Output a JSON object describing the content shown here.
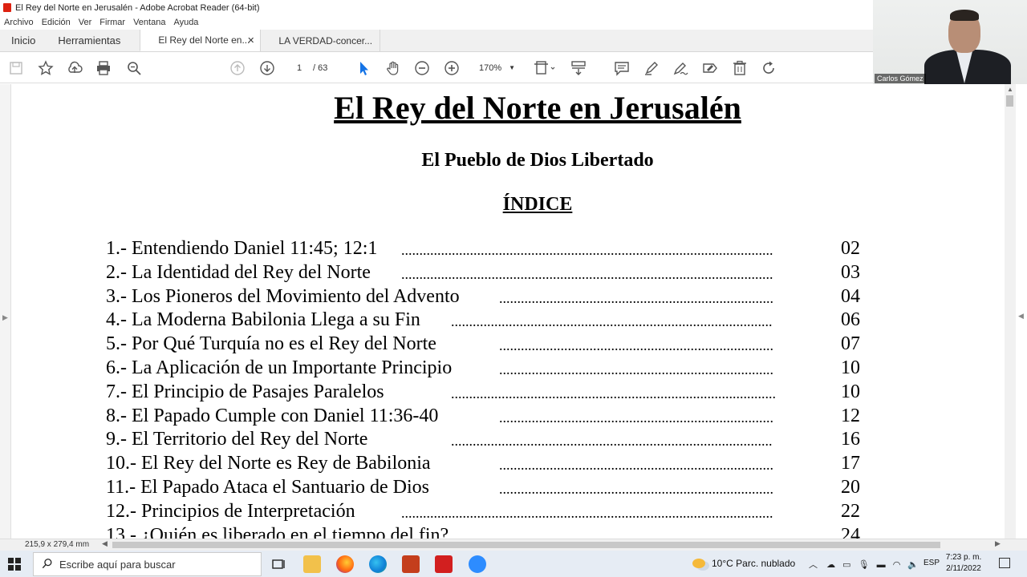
{
  "window": {
    "title": "El Rey del Norte en Jerusalén - Adobe Acrobat Reader (64-bit)"
  },
  "menu": [
    "Archivo",
    "Edición",
    "Ver",
    "Firmar",
    "Ventana",
    "Ayuda"
  ],
  "tabs": {
    "home": "Inicio",
    "tools": "Herramientas",
    "doc1": "El Rey del Norte en...",
    "doc2": "LA VERDAD-concer..."
  },
  "toolbar": {
    "current_page": "1",
    "total_pages": "/ 63",
    "zoom": "170%"
  },
  "webcam": {
    "name": "Carlos Gómez"
  },
  "document": {
    "title": "El Rey del Norte en Jerusalén",
    "subtitle": "El Pueblo de Dios Libertado",
    "index_heading": "ÍNDICE",
    "toc": [
      {
        "label": "1.- Entendiendo Daniel 11:45; 12:1",
        "page": "02"
      },
      {
        "label": "2.- La Identidad del Rey del Norte",
        "page": "03"
      },
      {
        "label": "3.- Los Pioneros del Movimiento del Advento",
        "page": "04"
      },
      {
        "label": "4.- La Moderna Babilonia Llega a su Fin",
        "page": "06"
      },
      {
        "label": "5.- Por Qué Turquía no es el Rey del Norte",
        "page": "07"
      },
      {
        "label": "6.- La Aplicación de un Importante Principio",
        "page": "10"
      },
      {
        "label": "7.- El Principio de Pasajes Paralelos",
        "page": "10"
      },
      {
        "label": "8.- El Papado Cumple con Daniel 11:36-40",
        "page": "12"
      },
      {
        "label": "9.- El Territorio del Rey del Norte",
        "page": "16"
      },
      {
        "label": "10.- El Rey del Norte es Rey de Babilonia",
        "page": "17"
      },
      {
        "label": "11.- El Papado Ataca el Santuario de Dios",
        "page": "20"
      },
      {
        "label": "12.- Principios de Interpretación",
        "page": "22"
      },
      {
        "label": "13.- ¿Quién es liberado en el tiempo del fin?",
        "page": "24"
      }
    ]
  },
  "status": {
    "page_size": "215,9 x 279,4 mm"
  },
  "taskbar": {
    "search_placeholder": "Escribe aquí para buscar",
    "weather": "10°C  Parc. nublado",
    "language": "ESP",
    "time": "7:23 p. m.",
    "date": "2/11/2022"
  },
  "colors": {
    "acrobat_red": "#d21f1f",
    "select_blue": "#1473e6"
  }
}
